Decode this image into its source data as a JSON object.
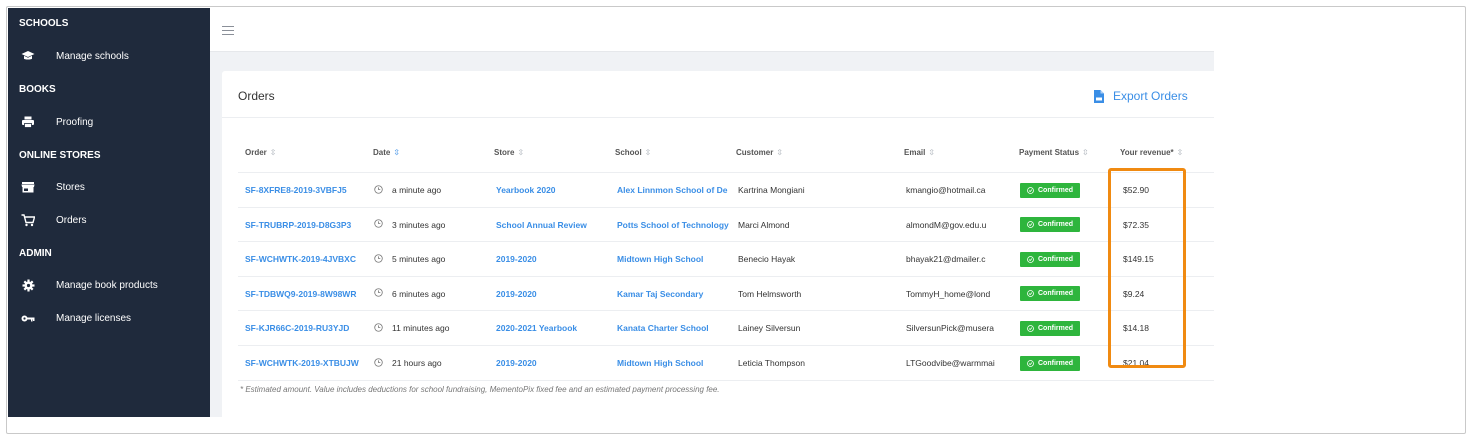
{
  "sidebar": {
    "sections": [
      {
        "title": "SCHOOLS",
        "items": [
          {
            "label": "Manage schools",
            "icon": "graduation-cap-icon"
          }
        ]
      },
      {
        "title": "BOOKS",
        "items": [
          {
            "label": "Proofing",
            "icon": "printer-icon"
          }
        ]
      },
      {
        "title": "ONLINE STORES",
        "items": [
          {
            "label": "Stores",
            "icon": "store-icon"
          },
          {
            "label": "Orders",
            "icon": "cart-icon"
          }
        ]
      },
      {
        "title": "ADMIN",
        "items": [
          {
            "label": "Manage book products",
            "icon": "gear-icon"
          },
          {
            "label": "Manage licenses",
            "icon": "key-icon"
          }
        ]
      }
    ]
  },
  "orders": {
    "title": "Orders",
    "export_label": "Export Orders",
    "columns": [
      "Order",
      "Date",
      "Store",
      "School",
      "Customer",
      "Email",
      "Payment Status",
      "Your revenue*"
    ],
    "rows": [
      {
        "order": "SF-8XFRE8-2019-3VBFJ5",
        "date": "a minute ago",
        "store": "Yearbook 2020",
        "school": "Alex Linnmon School of De",
        "customer": "Kartrina Mongiani",
        "email": "kmangio@hotmail.ca",
        "status": "Confirmed",
        "revenue": "$52.90"
      },
      {
        "order": "SF-TRUBRP-2019-D8G3P3",
        "date": "3 minutes ago",
        "store": "School Annual Review",
        "school": "Potts School of Technology",
        "customer": "Marci Almond",
        "email": "almondM@gov.edu.u",
        "status": "Confirmed",
        "revenue": "$72.35"
      },
      {
        "order": "SF-WCHWTK-2019-4JVBXC",
        "date": "5 minutes ago",
        "store": "2019-2020",
        "school": "Midtown High School",
        "customer": "Benecio Hayak",
        "email": "bhayak21@dmailer.c",
        "status": "Confirmed",
        "revenue": "$149.15"
      },
      {
        "order": "SF-TDBWQ9-2019-8W98WR",
        "date": "6 minutes ago",
        "store": "2019-2020",
        "school": "Kamar Taj Secondary",
        "customer": "Tom Helmsworth",
        "email": "TommyH_home@lond",
        "status": "Confirmed",
        "revenue": "$9.24"
      },
      {
        "order": "SF-KJR66C-2019-RU3YJD",
        "date": "11 minutes ago",
        "store": "2020-2021 Yearbook",
        "school": "Kanata Charter School",
        "customer": "Lainey Silversun",
        "email": "SilversunPick@musera",
        "status": "Confirmed",
        "revenue": "$14.18"
      },
      {
        "order": "SF-WCHWTK-2019-XTBUJW",
        "date": "21 hours ago",
        "store": "2019-2020",
        "school": "Midtown High School",
        "customer": "Leticia Thompson",
        "email": "LTGoodvibe@warmmai",
        "status": "Confirmed",
        "revenue": "$21.04"
      }
    ],
    "footnote": "* Estimated amount. Value includes deductions for school fundraising, MementoPix fixed fee and an estimated payment processing fee."
  },
  "colors": {
    "sidebar_bg": "#1f2a3c",
    "link": "#3a8ee6",
    "confirmed": "#2eb53d",
    "highlight": "#f08a11"
  }
}
